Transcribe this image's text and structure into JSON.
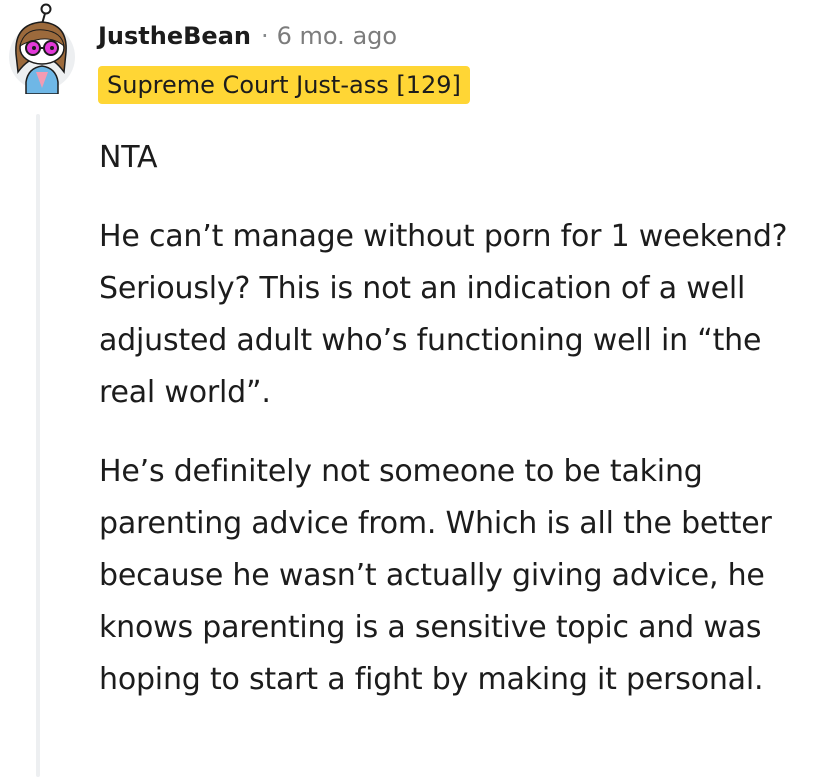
{
  "comment": {
    "username": "JustheBean",
    "separator": "·",
    "timestamp": "6 mo. ago",
    "flair": "Supreme Court Just-ass [129]",
    "avatar": "snoo-avatar-icon",
    "paragraphs": [
      "NTA",
      "He can’t manage without porn for 1 weekend? Seriously? This is not an indication of a well adjusted adult who’s functioning well in “the real world”.",
      "He’s definitely not someone to be taking parenting advice from. Which is all the better because he wasn’t actually giving advice, he knows parenting is a sensitive topic and was hoping to start a fight by making it personal."
    ]
  },
  "colors": {
    "flair_background": "#ffd635",
    "thread_line": "#edeff1",
    "text": "#1c1c1c",
    "muted": "#7c7c7c"
  }
}
